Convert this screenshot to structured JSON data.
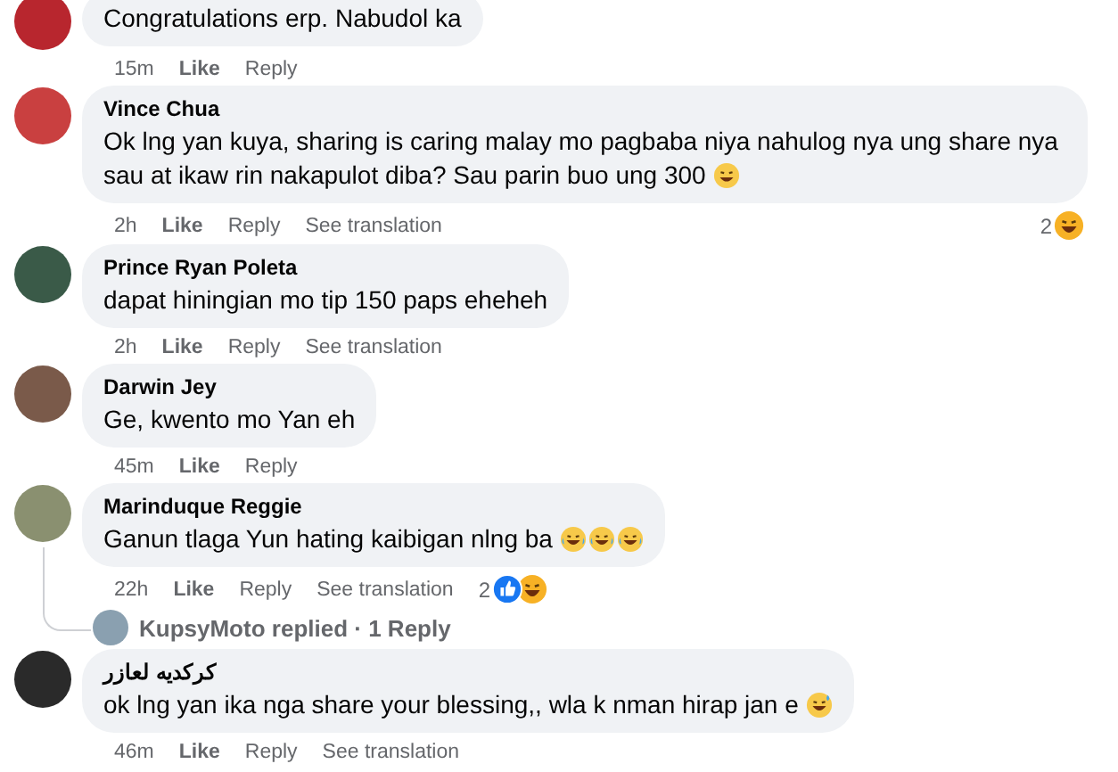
{
  "comments": [
    {
      "text": "Congratulations erp. Nabudol ka",
      "time": "15m",
      "actions": [
        "Like",
        "Reply"
      ]
    },
    {
      "author": "Vince Chua",
      "text": "Ok lng yan kuya, sharing is caring malay mo pagbaba niya nahulog nya ung share nya sau at ikaw rin nakapulot diba? Sau parin buo ung 300",
      "emojis": [
        {
          "kind": "rofl"
        }
      ],
      "time": "2h",
      "actions": [
        "Like",
        "Reply",
        "See translation"
      ],
      "reactions": {
        "count": "2",
        "types": [
          {
            "kind": "haha"
          }
        ]
      }
    },
    {
      "author": "Prince Ryan Poleta",
      "text": "dapat hiningian mo tip 150 paps eheheh",
      "time": "2h",
      "actions": [
        "Like",
        "Reply",
        "See translation"
      ]
    },
    {
      "author": "Darwin Jey",
      "text": "Ge, kwento mo Yan eh",
      "time": "45m",
      "actions": [
        "Like",
        "Reply"
      ]
    },
    {
      "author": "Marinduque Reggie",
      "text": "Ganun tlaga Yun hating kaibigan nlng ba",
      "emojis": [
        {
          "kind": "tears"
        },
        {
          "kind": "tears"
        },
        {
          "kind": "tears"
        }
      ],
      "time": "22h",
      "actions": [
        "Like",
        "Reply",
        "See translation"
      ],
      "reactions": {
        "count": "2",
        "types": [
          {
            "kind": "like"
          },
          {
            "kind": "haha"
          }
        ]
      },
      "replies": {
        "name": "KupsyMoto",
        "label": "replied · 1 Reply"
      }
    },
    {
      "author": "كركديه لعازر",
      "text": "ok lng yan ika nga share your blessing,, wla k nman hirap jan e",
      "emojis": [
        {
          "kind": "sweat"
        }
      ],
      "time": "46m",
      "actions": [
        "Like",
        "Reply",
        "See translation"
      ]
    }
  ]
}
